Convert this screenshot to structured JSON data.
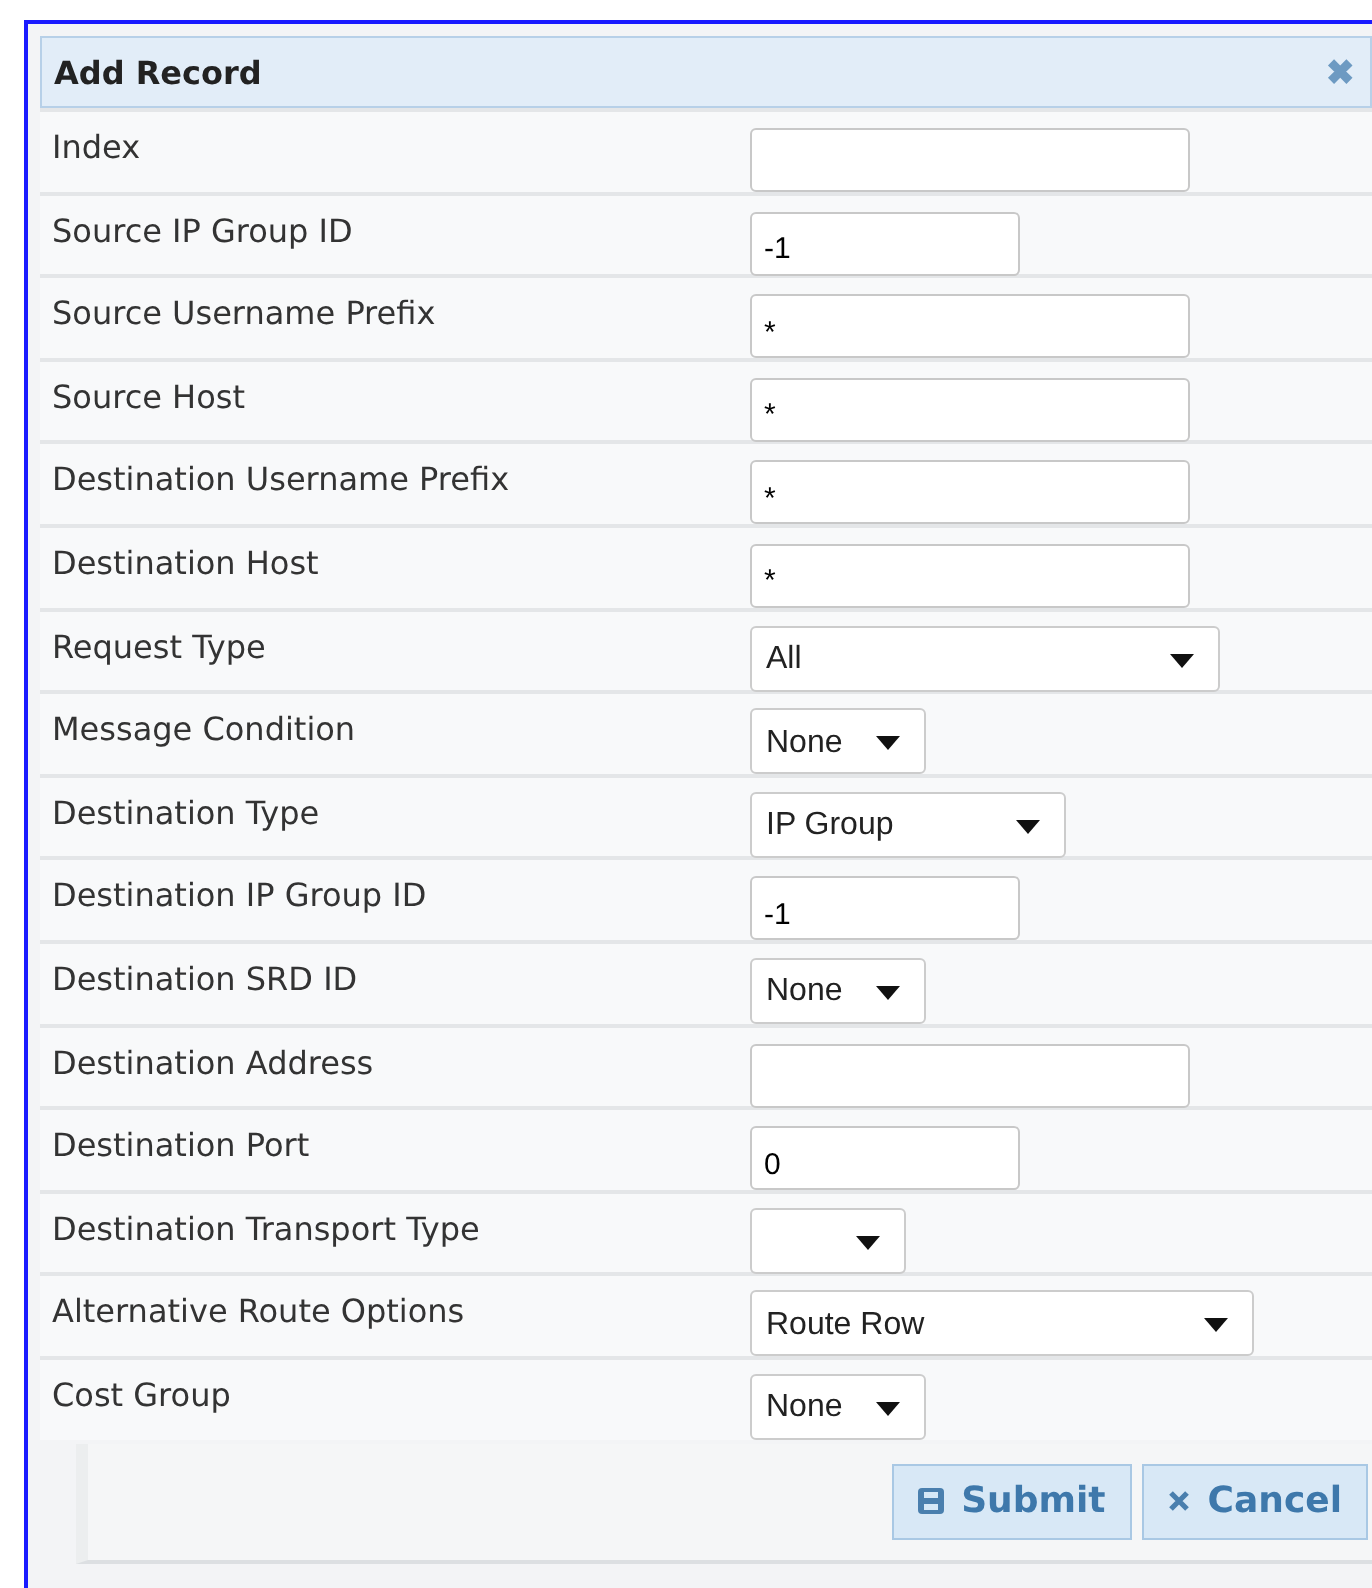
{
  "dialog": {
    "title": "Add Record",
    "close": "✖"
  },
  "fields": [
    {
      "label": "Index",
      "kind": "text"
    },
    {
      "label": "Source IP Group ID",
      "kind": "text",
      "value": "-1"
    },
    {
      "label": "Source Username Prefix",
      "kind": "text",
      "value": "*"
    },
    {
      "label": "Source Host",
      "kind": "text",
      "value": "*"
    },
    {
      "label": "Destination Username Prefix",
      "kind": "text",
      "value": "*"
    },
    {
      "label": "Destination Host",
      "kind": "text",
      "value": "*"
    },
    {
      "label": "Request Type",
      "kind": "select",
      "value": "All"
    },
    {
      "label": "Message Condition",
      "kind": "select",
      "value": "None"
    },
    {
      "label": "Destination Type",
      "kind": "select",
      "value": "IP Group"
    },
    {
      "label": "Destination IP Group ID",
      "kind": "text",
      "value": "-1"
    },
    {
      "label": "Destination SRD ID",
      "kind": "select",
      "value": "None"
    },
    {
      "label": "Destination Address",
      "kind": "text"
    },
    {
      "label": "Destination Port",
      "kind": "text",
      "value": "0"
    },
    {
      "label": "Destination Transport Type",
      "kind": "select"
    },
    {
      "label": "Alternative Route Options",
      "kind": "select",
      "value": "Route Row"
    },
    {
      "label": "Cost Group",
      "kind": "select",
      "value": "None"
    }
  ],
  "buttons": [
    {
      "kind": "submit",
      "label": "Submit"
    },
    {
      "kind": "cancel",
      "label": "Cancel"
    }
  ]
}
